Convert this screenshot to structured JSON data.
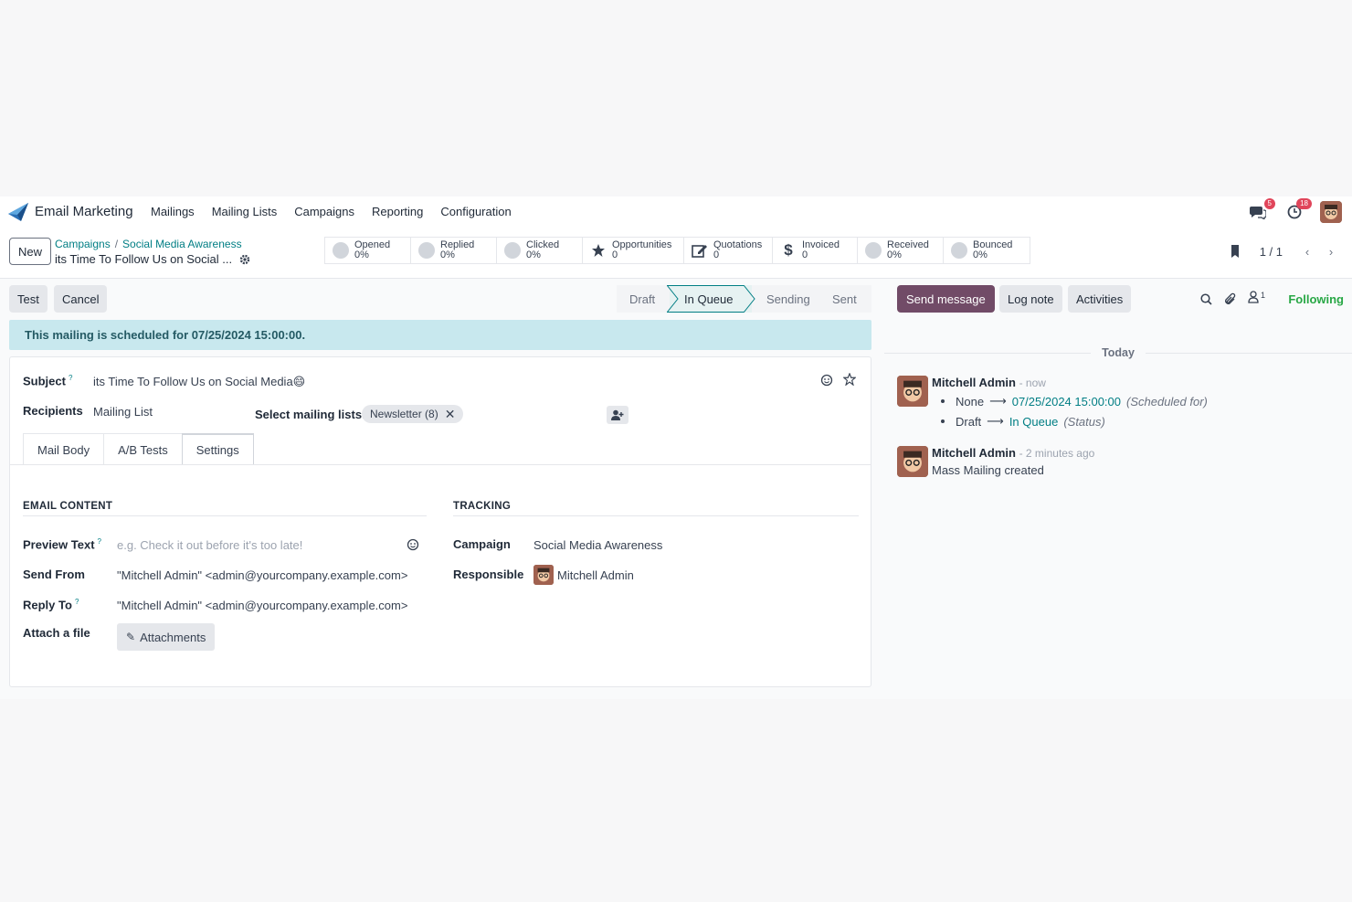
{
  "navbar": {
    "app_name": "Email Marketing",
    "menu": [
      "Mailings",
      "Mailing Lists",
      "Campaigns",
      "Reporting",
      "Configuration"
    ],
    "messages_badge": "5",
    "activities_badge": "18"
  },
  "control": {
    "new_label": "New",
    "breadcrumb": [
      "Campaigns",
      "Social Media Awareness"
    ],
    "record_title": "its Time To Follow Us on Social ...",
    "stats": [
      {
        "label": "Opened",
        "value": "0%"
      },
      {
        "label": "Replied",
        "value": "0%"
      },
      {
        "label": "Clicked",
        "value": "0%"
      },
      {
        "label": "Opportunities",
        "value": "0"
      },
      {
        "label": "Quotations",
        "value": "0"
      },
      {
        "label": "Invoiced",
        "value": "0"
      },
      {
        "label": "Received",
        "value": "0%"
      },
      {
        "label": "Bounced",
        "value": "0%"
      }
    ],
    "pager": "1 / 1"
  },
  "statusbar": {
    "test_label": "Test",
    "cancel_label": "Cancel",
    "stages": [
      "Draft",
      "In Queue",
      "Sending",
      "Sent"
    ],
    "active_stage": "In Queue"
  },
  "alert": "This mailing is scheduled for 07/25/2024 15:00:00.",
  "form": {
    "subject_label": "Subject",
    "subject_value": "its Time To Follow Us on Social Media😄",
    "recipients_label": "Recipients",
    "recipients_value": "Mailing List",
    "select_lists_label": "Select mailing lists:",
    "list_tag": "Newsletter (8)",
    "tabs": [
      "Mail Body",
      "A/B Tests",
      "Settings"
    ],
    "active_tab": "Settings",
    "email_content": {
      "title": "EMAIL CONTENT",
      "preview_label": "Preview Text",
      "preview_placeholder": "e.g. Check it out before it's too late!",
      "send_from_label": "Send From",
      "send_from_value": "\"Mitchell Admin\" <admin@yourcompany.example.com>",
      "reply_to_label": "Reply To",
      "reply_to_value": "\"Mitchell Admin\" <admin@yourcompany.example.com>",
      "attach_label": "Attach a file",
      "attach_button": "Attachments"
    },
    "tracking": {
      "title": "TRACKING",
      "campaign_label": "Campaign",
      "campaign_value": "Social Media Awareness",
      "responsible_label": "Responsible",
      "responsible_value": "Mitchell Admin"
    }
  },
  "chatter": {
    "send_message": "Send message",
    "log_note": "Log note",
    "activities": "Activities",
    "followers_count": "1",
    "following": "Following",
    "today": "Today",
    "messages": [
      {
        "author": "Mitchell Admin",
        "time": "- now",
        "changes": [
          {
            "from": "None",
            "to": "07/25/2024 15:00:00",
            "field": "(Scheduled for)"
          },
          {
            "from": "Draft",
            "to": "In Queue",
            "field": "(Status)"
          }
        ]
      },
      {
        "author": "Mitchell Admin",
        "time": "- 2 minutes ago",
        "body": "Mass Mailing created"
      }
    ]
  },
  "colors": {
    "primary": "#714b67",
    "link": "#017e84",
    "alert_bg": "#c8e8ee",
    "following": "#28a745"
  }
}
